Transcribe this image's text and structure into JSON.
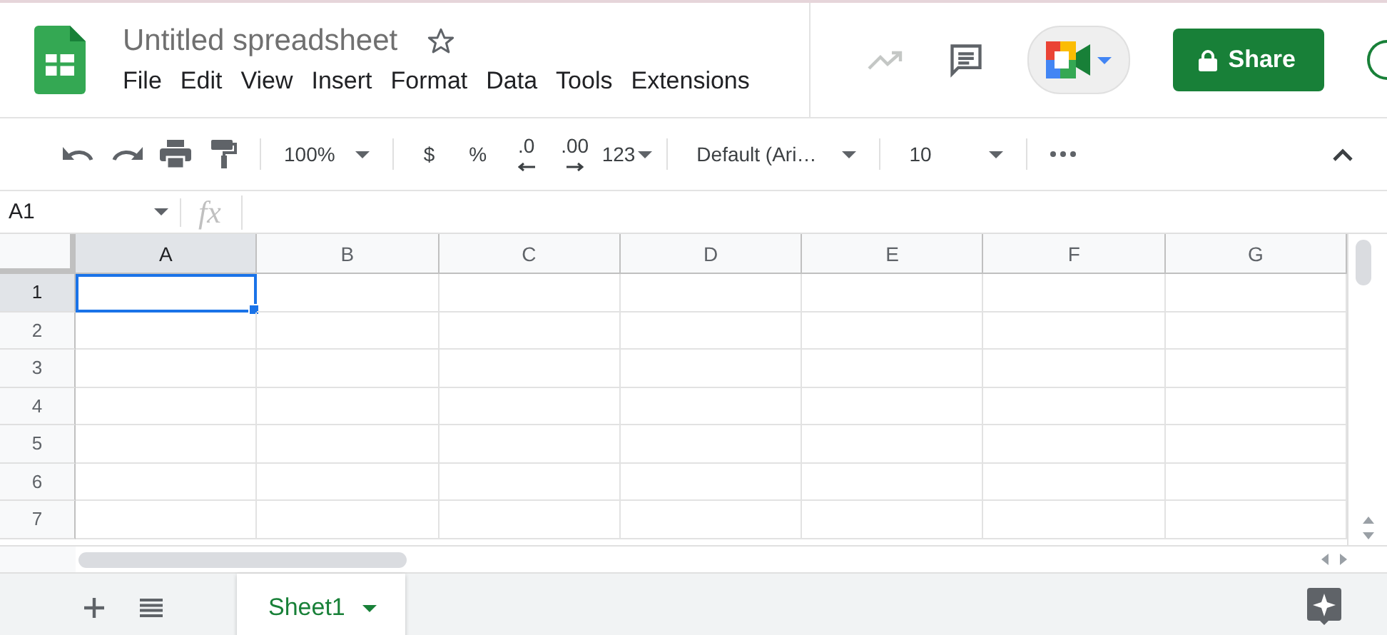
{
  "header": {
    "title": "Untitled spreadsheet",
    "starred": false,
    "menu": [
      "File",
      "Edit",
      "View",
      "Insert",
      "Format",
      "Data",
      "Tools",
      "Extensions"
    ],
    "share": "Share"
  },
  "toolbar": {
    "zoom": "100%",
    "currency": "$",
    "percent": "%",
    "decimal_decrease": ".0",
    "decimal_increase": ".00",
    "number_format": "123",
    "font": "Default (Ari…",
    "font_size": "10"
  },
  "formula_bar": {
    "name_box": "A1",
    "fx": "fx"
  },
  "columns": [
    {
      "label": "A",
      "selected": true
    },
    {
      "label": "B",
      "selected": false
    },
    {
      "label": "C",
      "selected": false
    },
    {
      "label": "D",
      "selected": false
    },
    {
      "label": "E",
      "selected": false
    },
    {
      "label": "F",
      "selected": false
    },
    {
      "label": "G",
      "selected": false
    }
  ],
  "rows": [
    {
      "label": "1",
      "selected": true
    },
    {
      "label": "2",
      "selected": false
    },
    {
      "label": "3",
      "selected": false
    },
    {
      "label": "4",
      "selected": false
    },
    {
      "label": "5",
      "selected": false
    },
    {
      "label": "6",
      "selected": false
    },
    {
      "label": "7",
      "selected": false
    }
  ],
  "sheet_tabs": [
    {
      "label": "Sheet1",
      "selected": true
    }
  ]
}
